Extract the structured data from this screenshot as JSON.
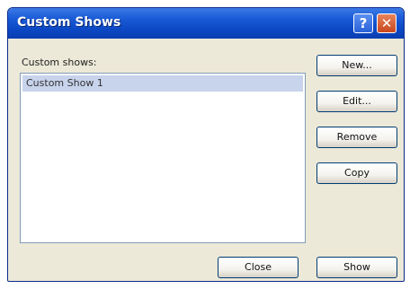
{
  "window": {
    "title": "Custom Shows",
    "help_glyph": "?",
    "close_glyph": "✕"
  },
  "list": {
    "label": "Custom shows:",
    "items": [
      "Custom Show 1"
    ],
    "selected_index": 0
  },
  "buttons": {
    "new": "New...",
    "edit": "Edit...",
    "remove": "Remove",
    "copy": "Copy",
    "close": "Close",
    "show": "Show"
  }
}
